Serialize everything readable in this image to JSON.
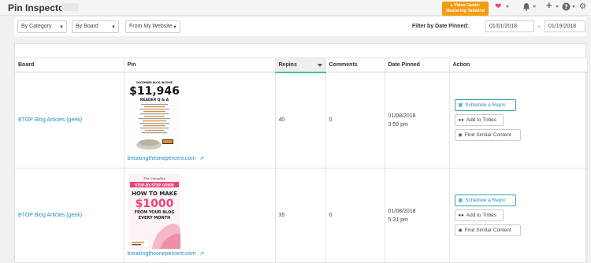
{
  "header": {
    "title": "Pin Inspector",
    "video_guide": {
      "line1": "Video Guide:",
      "line2": "Mastering Tailwind"
    }
  },
  "filters": {
    "by_category": "By Category",
    "by_board": "By Board",
    "from_site": "From My Website",
    "date_label": "Filter by Date Pinned:",
    "date_from": "01/01/2018",
    "date_to": "01/19/2018"
  },
  "table": {
    "columns": [
      "Board",
      "Pin",
      "Repins",
      "Comments",
      "Date Pinned",
      "Action"
    ],
    "rows": [
      {
        "board": "BTOP Blog Articles (geek)",
        "pin_source": "breakingtheonepercent.com",
        "pin_text": {
          "small": "DECEMBER BLOG INCOME",
          "amount": "$11,946",
          "sub": "READER Q & A"
        },
        "repins": "40",
        "comments": "0",
        "date": "01/08/2018",
        "time": "3:59 pm"
      },
      {
        "board": "BTOP Blog Articles (geek)",
        "pin_source": "breakingtheonepercent.com",
        "pin_text": {
          "small": "The Complete",
          "guide": "STEP-BY-STEP GUIDE",
          "line1": "HOW TO MAKE",
          "amount": "$1000",
          "line2": "FROM YOUR BLOG",
          "line3": "EVERY MONTH"
        },
        "repins": "35",
        "comments": "0",
        "date": "01/08/2018",
        "time": "5:31 pm"
      }
    ]
  },
  "actions": {
    "schedule": "Schedule a Repin",
    "tribes": "Add to Tribes",
    "similar": "Find Similar Content"
  },
  "colors": {
    "accent": "#41c1a3",
    "link": "#2a8fc7",
    "video_guide_bg": "#f39c12",
    "heart": "#e0457b",
    "pin_pink": "#e8437c"
  }
}
